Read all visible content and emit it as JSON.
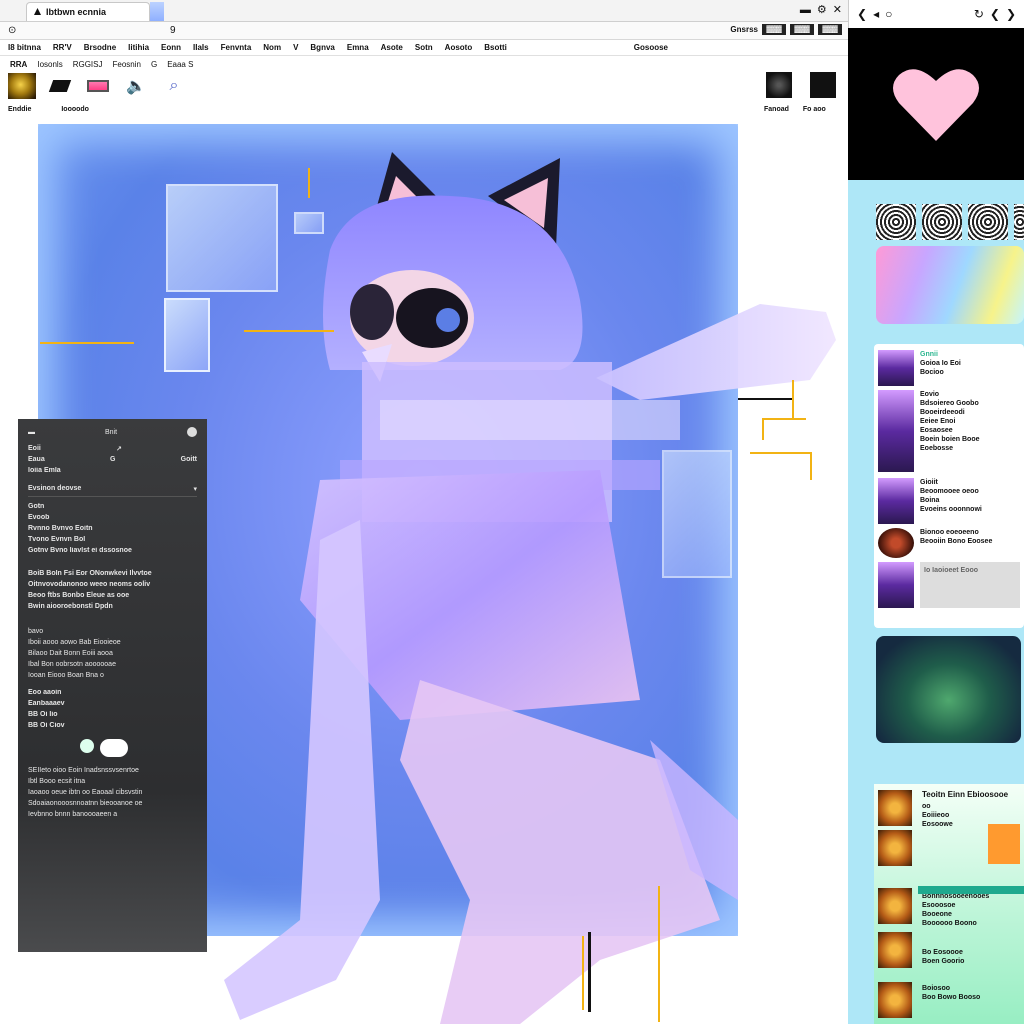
{
  "browser": {
    "tab_title": "Ibtbwn ecnnia",
    "address_mark": "9",
    "addr_right": [
      "Gnsrss"
    ],
    "addr_boxes": [
      "▓▓▓",
      "▓▓▓",
      "▓▓▓"
    ],
    "menu": [
      "I8 bitnna",
      "RR'V",
      "Brsodne",
      "Iitihia",
      "Eonn",
      "IIaIs",
      "Fenvnta",
      "Nom",
      "V",
      "Bgnva",
      "Emna",
      "Asote",
      "Sotn",
      "Aosoto",
      "Bsotti"
    ],
    "menu_right": "Gosoose",
    "bookmarks": [
      "RRA",
      "Iosonls",
      "RGGISJ",
      "Feosnin",
      "G",
      "Eaaa S"
    ]
  },
  "tools": {
    "labels": [
      "Enddie",
      "Ioooodo"
    ],
    "right_labels": [
      "Fanoad",
      "Fo aoo"
    ]
  },
  "panel": {
    "title": "Bnit",
    "rows": [
      {
        "left": "Eoii",
        "mid": "↗",
        "right": ""
      },
      {
        "left": "Eaua",
        "mid": "G",
        "right": "Goitt"
      }
    ],
    "subhead": "Ioiia Emla",
    "dropdown": "Evsinon deovse",
    "items": [
      "Gotn",
      "Evoob",
      "Rvnno Bvnvo Eoitn",
      "Tvono Evnvn BoI",
      "Gotnv Bvno Iiavlst ei dssosnoe"
    ],
    "para1": [
      "BoiB BoIn Fsi Eor ONonwkevi Ilvvtoe",
      "Oitnvovodanonoo weeo neoms ooliv",
      "Beoo ftbs Bonbo Eleue as ooe",
      "Bwin aiooroebonsti Dpdn"
    ],
    "para2": [
      "bavo",
      "Iboii aooo aowo Bab Eiooieoe",
      "Bilaoo Dait Bonn Eoiii aooa",
      "Ibal Bon oobrsotn aoooooae",
      "Iooan Eiooo Boan Bna o"
    ],
    "short_items": [
      "Eoo aaoin",
      "Eanbaaaev",
      "BB Oi Iio",
      "BB Oi Ciov"
    ],
    "para3": [
      "SEIIeto oioo Eoin Inadsnssvsenrtoe",
      "Ibtl Booo ecsit itna",
      "Iaoaoo oeue ibtn oo Eaoaal cibsvstin",
      "Sdoaiaonooosnnoatnn bieooanoe oe",
      "Ievbnno bnnn banoooaeen a"
    ]
  },
  "sidebar": {
    "top_left": [
      "❮",
      "◂",
      "○"
    ],
    "top_right": [
      "↻",
      "❮",
      "❯"
    ],
    "list": [
      {
        "lines": [
          "Gnnii",
          "Goioa Io Eoi",
          "Bocioo"
        ]
      },
      {
        "lines": [
          "Eovio",
          "Bdsoiereo Goobo",
          "Booeirdeeodi",
          "Eeiee Enoi",
          "Eosaosee",
          "Boein boien Booe",
          "Eoebosse"
        ]
      },
      {
        "lines": [
          "Gioiit",
          "Beoomooee oeoo",
          "Boina",
          "Evoeins ooonnowi"
        ]
      },
      {
        "lines": [
          "Bionoo eoeoeeno",
          "Beooiin Bono Eoosee"
        ]
      },
      {
        "lines": [
          "Io Iaoioeet Eooo"
        ]
      }
    ],
    "bottom_title": "Teoitn Einn Ebioosooe",
    "bottom_items": [
      {
        "lines": [
          "oo",
          "Eoiiieoo",
          "Eosoowe"
        ]
      },
      {
        "lines": [
          "Bonnnosooeenooes",
          "Esooosoe",
          "Booeone",
          "Boooooo Boono"
        ]
      },
      {
        "lines": [
          "Bo Eosoooe",
          "Boen Goorio"
        ]
      },
      {
        "lines": [
          "Boiosoo",
          "Boo Bowo Booso"
        ]
      }
    ]
  },
  "colors": {
    "canvas_bg": "#6a87ee",
    "accent_guide": "#f2b314",
    "panel_bg": "#2d2e30",
    "sidebar_bg": "#aee7f7",
    "heart": "#ffc3dc"
  }
}
